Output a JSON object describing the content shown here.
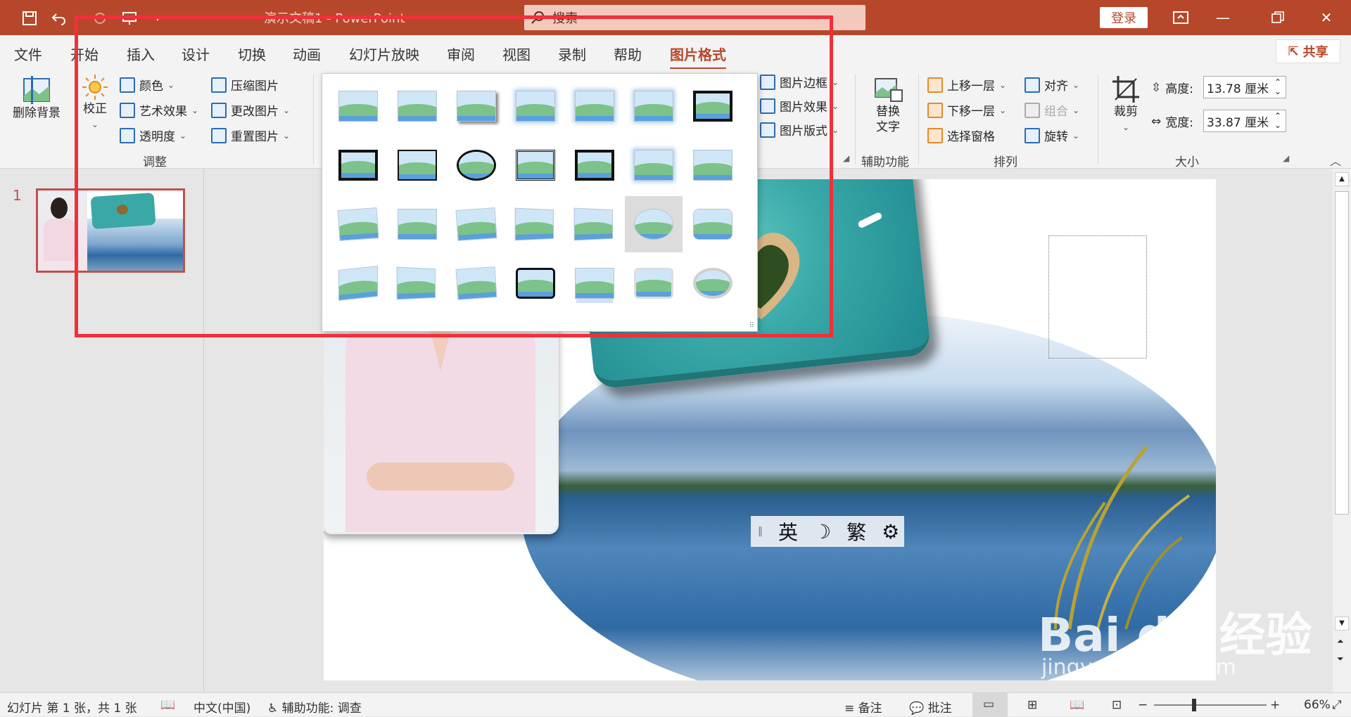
{
  "titlebar": {
    "title": "演示文稿1 - PowerPoint",
    "search_placeholder": "搜索",
    "login": "登录"
  },
  "tabs": [
    "文件",
    "开始",
    "插入",
    "设计",
    "切换",
    "动画",
    "幻灯片放映",
    "审阅",
    "视图",
    "录制",
    "帮助",
    "图片格式"
  ],
  "active_tab": "图片格式",
  "share": "共享",
  "ribbon": {
    "remove_bg": "删除背景",
    "correct": "校正",
    "color": "颜色",
    "art_effects": "艺术效果",
    "transparency": "透明度",
    "compress": "压缩图片",
    "change_pic": "更改图片",
    "reset_pic": "重置图片",
    "adjust_group": "调整",
    "pic_border": "图片边框",
    "pic_effects": "图片效果",
    "pic_layout": "图片版式",
    "alt_text_l1": "替换",
    "alt_text_l2": "文字",
    "accessibility_group": "辅助功能",
    "bring_forward": "上移一层",
    "send_backward": "下移一层",
    "selection_pane": "选择窗格",
    "align": "对齐",
    "group": "组合",
    "rotate": "旋转",
    "arrange_group": "排列",
    "crop": "裁剪",
    "height_label": "高度:",
    "height_value": "13.78 厘米",
    "width_label": "宽度:",
    "width_value": "33.87 厘米",
    "size_group": "大小"
  },
  "thumbnail": {
    "number": "1"
  },
  "ime": {
    "lang": "英",
    "moon": "☽",
    "trad": "繁"
  },
  "statusbar": {
    "slide_info": "幻灯片 第 1 张，共 1 张",
    "language": "中文(中国)",
    "accessibility": "辅助功能: 调查",
    "notes": "备注",
    "comments": "批注",
    "zoom": "66%"
  },
  "watermark": {
    "brand": "Bai du 经验",
    "url": "jingyan.baidu.com"
  }
}
